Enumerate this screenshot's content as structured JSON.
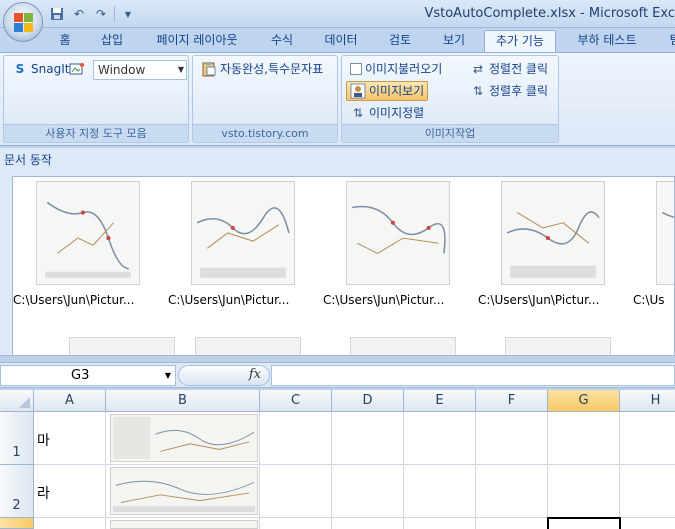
{
  "window": {
    "title": "VstoAutoComplete.xlsx - Microsoft Exc"
  },
  "quick_access": {
    "save_icon": "save-icon",
    "undo_icon": "undo-icon",
    "redo_icon": "redo-icon"
  },
  "tabs": [
    {
      "label": "홈"
    },
    {
      "label": "삽입"
    },
    {
      "label": "페이지 레이아웃"
    },
    {
      "label": "수식"
    },
    {
      "label": "데이터"
    },
    {
      "label": "검토"
    },
    {
      "label": "보기"
    },
    {
      "label": "추가 기능",
      "active": true
    },
    {
      "label": "부하 테스트"
    },
    {
      "label": "팀"
    }
  ],
  "ribbon": {
    "custom_toolbar": {
      "snagit_label": "SnagIt",
      "combo_value": "Window",
      "group_label": "사용자 지정 도구 모음"
    },
    "vsto_group": {
      "autocomplete_label": "자동완성,특수문자표",
      "group_label": "vsto.tistory.com"
    },
    "image_group": {
      "load_label": "이미지불러오기",
      "view_label": "이미지보기",
      "arrange_label": "이미지정렬",
      "before_sort_label": "정렬전 클릭",
      "after_sort_label": "정렬후 클릭",
      "group_label": "이미지작업"
    }
  },
  "document_pane": {
    "title": "문서 동작",
    "thumbnails": [
      {
        "caption": "C:\\Users\\Jun\\Pictur..."
      },
      {
        "caption": "C:\\Users\\Jun\\Pictur..."
      },
      {
        "caption": "C:\\Users\\Jun\\Pictur..."
      },
      {
        "caption": "C:\\Users\\Jun\\Pictur..."
      },
      {
        "caption": "C:\\Us"
      }
    ]
  },
  "formula_bar": {
    "name_box": "G3",
    "fx_label": "fx",
    "value": ""
  },
  "sheet": {
    "columns": [
      "A",
      "B",
      "C",
      "D",
      "E",
      "F",
      "G",
      "H"
    ],
    "selected_column": "G",
    "rows": [
      {
        "number": "1",
        "a": "마"
      },
      {
        "number": "2",
        "a": "라"
      }
    ],
    "active_cell": "G3"
  },
  "colors": {
    "accent": "#15428b",
    "selected_header": "#f7c866"
  }
}
